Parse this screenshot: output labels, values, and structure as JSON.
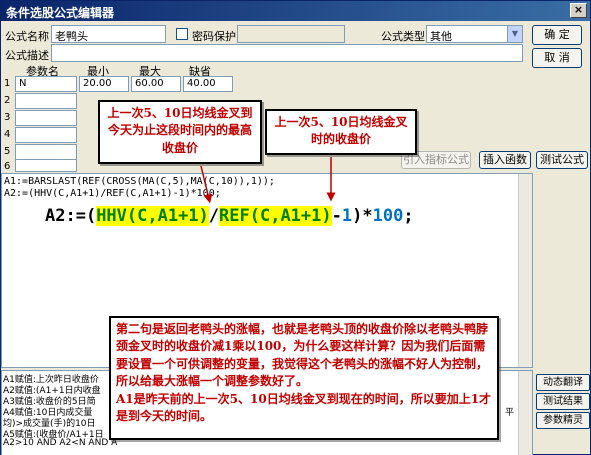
{
  "window": {
    "title": "条件选股公式编辑器",
    "close": "×"
  },
  "form": {
    "name_label": "公式名称",
    "name_value": "老鸭头",
    "password_label": "密码保护",
    "type_label": "公式类型",
    "type_value": "其他",
    "desc_label": "公式描述"
  },
  "buttons": {
    "ok": "确 定",
    "cancel": "取 消",
    "import": "引入指标公式",
    "insert": "插入函数",
    "test": "测试公式",
    "dynamic": "动态翻译",
    "result": "测试结果",
    "wizard": "参数精灵"
  },
  "params": {
    "headers": [
      "参数名",
      "最小",
      "最大",
      "缺省"
    ],
    "rows": [
      {
        "num": "1",
        "name": "N",
        "min": "20.00",
        "max": "60.00",
        "def": "40.00"
      },
      {
        "num": "2",
        "name": "",
        "min": "",
        "max": "",
        "def": ""
      },
      {
        "num": "3",
        "name": "",
        "min": "",
        "max": "",
        "def": ""
      },
      {
        "num": "4",
        "name": "",
        "min": "",
        "max": "",
        "def": ""
      },
      {
        "num": "5",
        "name": "",
        "min": "",
        "max": "",
        "def": ""
      },
      {
        "num": "6",
        "name": "",
        "min": "",
        "max": "",
        "def": ""
      }
    ]
  },
  "editor": {
    "line1": "A1:=BARSLAST(REF(CROSS(MA(C,5),MA(C,10)),1));",
    "line2": "A2:=(HHV(C,A1+1)/REF(C,A1+1)-1)*100;",
    "big": {
      "a": "A2:=(",
      "b": "HHV(C,A1+1)",
      "c": "/",
      "d": "REF(C,A1+1)",
      "e": "-",
      "f": "1",
      "g": ")*",
      "h": "100",
      "i": ";"
    }
  },
  "annotations": {
    "note1": "上一次5、10日均线金叉到今天为止这段时间内的最高收盘价",
    "note2": "上一次5、10日均线金叉时的收盘价",
    "note3a": "第二句是返回老鸭头的涨幅，也就是老鸭头顶的收盘价除以老鸭头鸭脖颈金叉时的收盘价减1乘以100，为什么要这样计算？因为我们后面需要设置一个可供调整的变量，我觉得这个老鸭头的涨幅不好人为控制，所以给最大涨幅一个调整参数好了。",
    "note3b": "A1是昨天前的上一次5、10日均线金叉到现在的时间，所以要加上1才是到今天的时间。"
  },
  "description": [
    "A1赋值:上次昨日收盘价",
    "A2赋值:(A1+1日内收盘",
    "A3赋值:收盘价的5日简",
    "A4赋值:10日内成交量",
    "均)>成交量(手)的10日",
    "A5赋值:(收盘价/A1+1日",
    "A2>10 AND A2<N AND A"
  ],
  "desc_tail": "平",
  "colors": {
    "title_bg": "#0a246a",
    "highlight": "#ffff00",
    "note_text": "#c00000"
  }
}
